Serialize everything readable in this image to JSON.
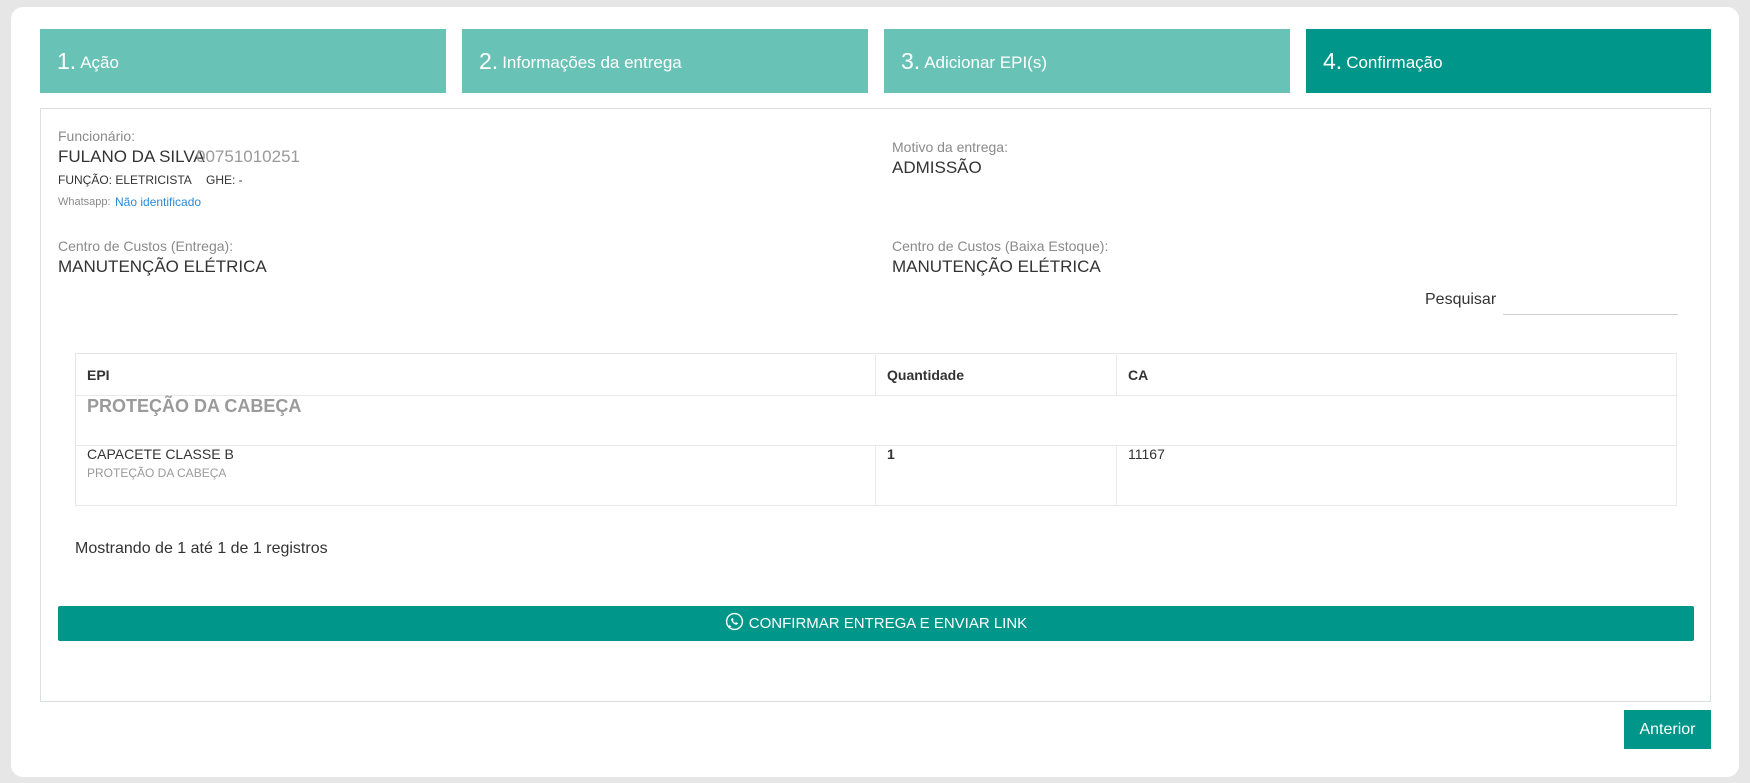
{
  "steps": [
    {
      "num": "1.",
      "label": "Ação"
    },
    {
      "num": "2.",
      "label": "Informações da entrega"
    },
    {
      "num": "3.",
      "label": "Adicionar EPI(s)"
    },
    {
      "num": "4.",
      "label": "Confirmação"
    }
  ],
  "active_step": 4,
  "employee": {
    "label": "Funcionário:",
    "name": "FULANO DA SILVA",
    "id": "00751010251",
    "function": "FUNÇÃO: ELETRICISTA",
    "ghe": "GHE: -",
    "whatsapp_label": "Whatsapp:",
    "whatsapp_value": "Não identificado"
  },
  "reason": {
    "label": "Motivo da entrega:",
    "value": "ADMISSÃO"
  },
  "cost_center_delivery": {
    "label": "Centro de Custos (Entrega):",
    "value": "MANUTENÇÃO ELÉTRICA"
  },
  "cost_center_stock": {
    "label": "Centro de Custos (Baixa Estoque):",
    "value": "MANUTENÇÃO ELÉTRICA"
  },
  "search": {
    "label": "Pesquisar",
    "value": ""
  },
  "table": {
    "headers": [
      "EPI",
      "Quantidade",
      "CA"
    ],
    "group": "PROTEÇÃO DA CABEÇA",
    "rows": [
      {
        "name": "CAPACETE CLASSE B",
        "category": "PROTEÇÃO DA CABEÇA",
        "quantity": "1",
        "ca": "11167"
      }
    ]
  },
  "showing": "Mostrando de 1 até 1 de 1 registros",
  "confirm_button": "CONFIRMAR ENTREGA E ENVIAR LINK",
  "prev_button": "Anterior",
  "colors": {
    "accent": "#00968a",
    "step_inactive": "#69c2b6",
    "link": "#2a8ad8"
  }
}
